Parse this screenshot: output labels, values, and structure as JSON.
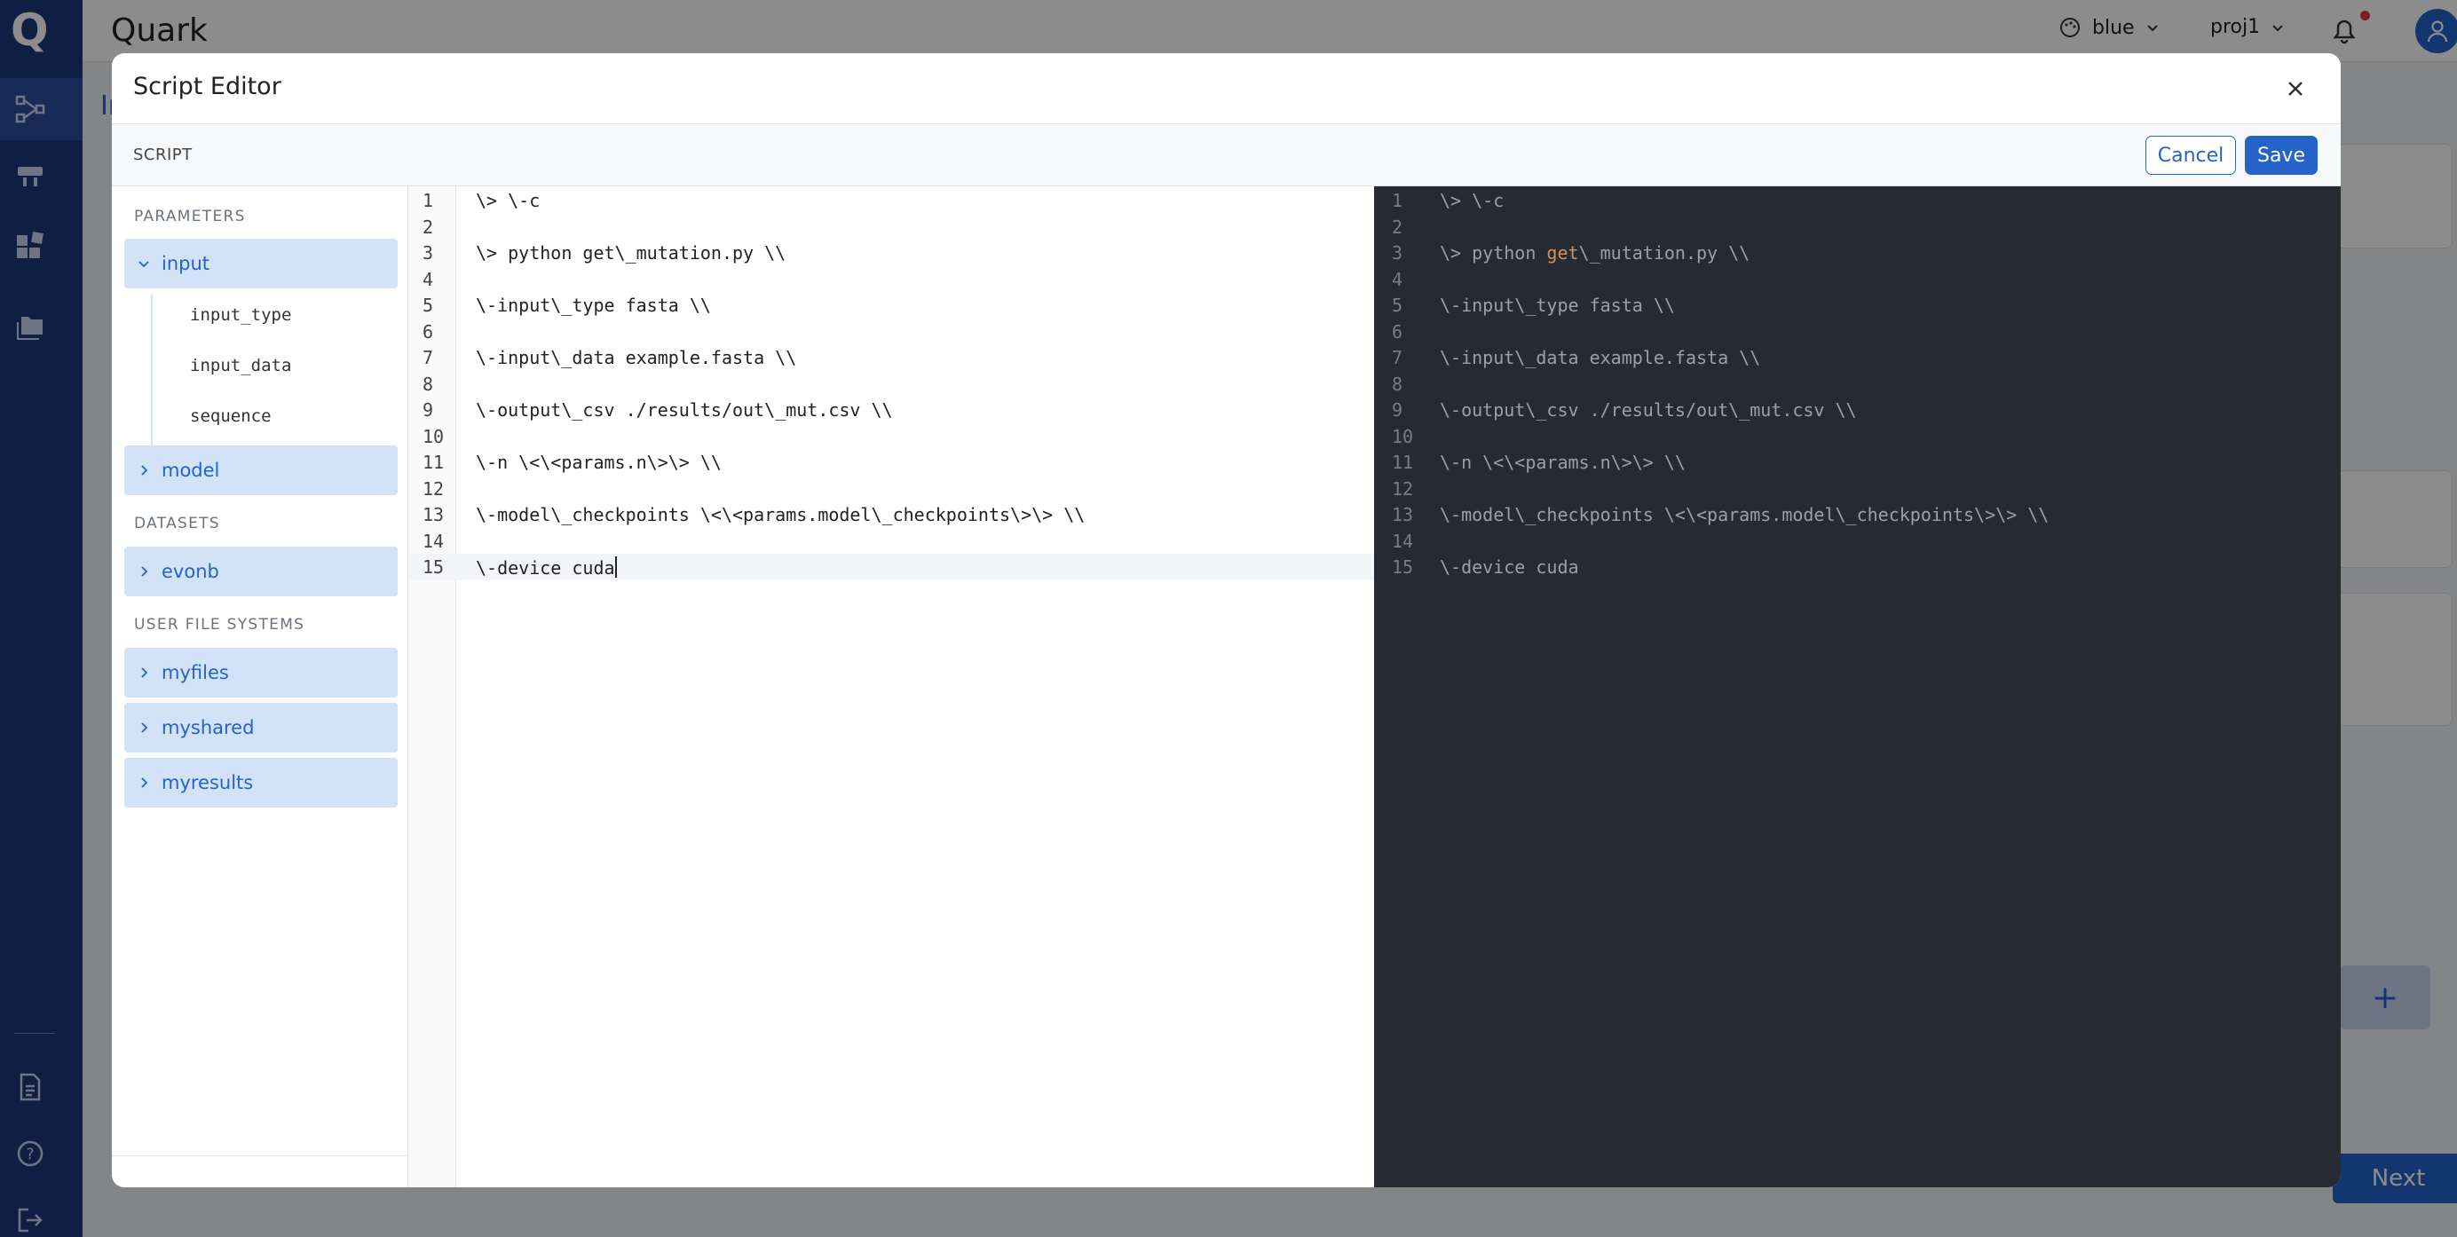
{
  "app": {
    "title": "Quark",
    "theme_select": "blue",
    "project_select": "proj1",
    "background_heading": "In",
    "next_label": "Next",
    "plus_label": "+"
  },
  "modal": {
    "title": "Script Editor",
    "section_label": "SCRIPT",
    "cancel_label": "Cancel",
    "save_label": "Save"
  },
  "sidebar": {
    "parameters_label": "PARAMETERS",
    "datasets_label": "DATASETS",
    "user_fs_label": "USER FILE SYSTEMS",
    "input_node": "input",
    "input_children": [
      "input_type",
      "input_data",
      "sequence"
    ],
    "model_node": "model",
    "datasets": [
      "evonb"
    ],
    "user_file_systems": [
      "myfiles",
      "myshared",
      "myresults"
    ]
  },
  "editor": {
    "line_numbers": [
      "1",
      "2",
      "3",
      "4",
      "5",
      "6",
      "7",
      "8",
      "9",
      "10",
      "11",
      "12",
      "13",
      "14",
      "15"
    ],
    "lines": [
      "\\> \\-c",
      "",
      "\\> python get\\_mutation.py \\\\",
      "",
      "\\-input\\_type fasta \\\\",
      "",
      "\\-input\\_data example.fasta \\\\",
      "",
      "\\-output\\_csv ./results/out\\_mut.csv \\\\",
      "",
      "\\-n \\<\\<params.n\\>\\> \\\\",
      "",
      "\\-model\\_checkpoints \\<\\<params.model\\_checkpoints\\>\\> \\\\",
      "",
      "\\-device cuda"
    ],
    "active_line": 15
  },
  "preview": {
    "line3_prefix": "\\> python ",
    "line3_keyword": "get",
    "line3_suffix": "\\_mutation.py \\\\"
  },
  "colors": {
    "accent": "#2563c9",
    "nav_bg": "#1c3a7c",
    "tree_node_bg": "#d2e2f7",
    "preview_bg": "#262a33",
    "preview_keyword": "#d0925a"
  }
}
